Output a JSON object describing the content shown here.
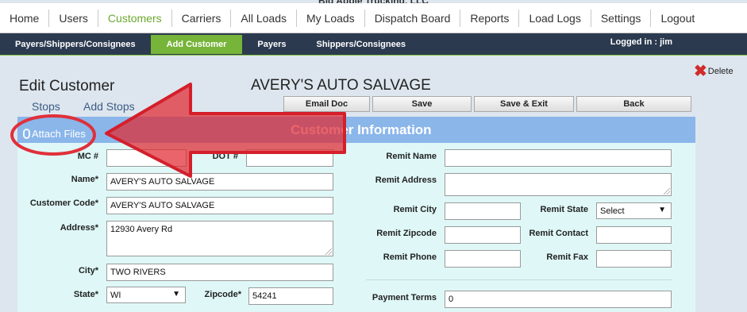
{
  "company": "Big Apple Trucking, LLC",
  "top_nav": [
    "Home",
    "Users",
    "Customers",
    "Carriers",
    "All Loads",
    "My Loads",
    "Dispatch Board",
    "Reports",
    "Load Logs",
    "Settings",
    "Logout"
  ],
  "active_top_nav": "Customers",
  "sub_nav": [
    "Payers/Shippers/Consignees",
    "Add Customer",
    "Payers",
    "Shippers/Consignees"
  ],
  "logged_in": "Logged in : jim",
  "delete_label": "Delete",
  "page_title": "Edit Customer",
  "customer_name": "AVERY'S AUTO SALVAGE",
  "links": {
    "stops": "Stops",
    "add_stops": "Add Stops"
  },
  "buttons": {
    "email_doc": "Email Doc",
    "save": "Save",
    "save_exit": "Save & Exit",
    "back": "Back"
  },
  "section_title": "Customer Information",
  "attach_files": "Attach Files",
  "form": {
    "mc_label": "MC #",
    "mc_value": "",
    "dot_label": "DOT #",
    "dot_value": "",
    "name_label": "Name*",
    "name_value": "AVERY'S AUTO SALVAGE",
    "code_label": "Customer Code*",
    "code_value": "AVERY'S AUTO SALVAGE",
    "address_label": "Address*",
    "address_value": "12930 Avery Rd",
    "city_label": "City*",
    "city_value": "TWO RIVERS",
    "state_label": "State*",
    "state_value": "WI",
    "zip_label": "Zipcode*",
    "zip_value": "54241",
    "remit_name_label": "Remit Name",
    "remit_name_value": "",
    "remit_address_label": "Remit Address",
    "remit_address_value": "",
    "remit_city_label": "Remit City",
    "remit_city_value": "",
    "remit_state_label": "Remit State",
    "remit_state_value": "Select",
    "remit_zip_label": "Remit Zipcode",
    "remit_zip_value": "",
    "remit_contact_label": "Remit Contact",
    "remit_contact_value": "",
    "remit_phone_label": "Remit Phone",
    "remit_phone_value": "",
    "remit_fax_label": "Remit Fax",
    "remit_fax_value": "",
    "payment_terms_label": "Payment Terms",
    "payment_terms_value": "0"
  },
  "colors": {
    "accent_green": "#77b43a",
    "header_blue": "#8ab6ea",
    "form_bg": "#dff7f7",
    "annotation_red": "#e0303a"
  }
}
